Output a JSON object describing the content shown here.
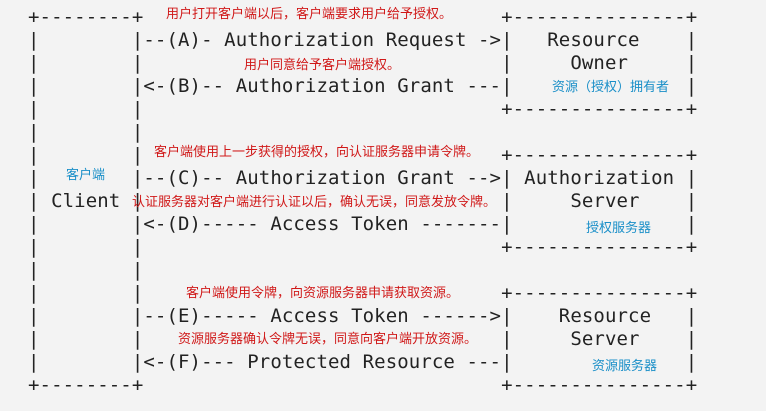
{
  "colors": {
    "background": "#f3f3f3",
    "diagram_text": "#222222",
    "annotation_red": "#d01818",
    "annotation_blue": "#1a8fc8"
  },
  "diagram_lines": [
    "+--------+                               +---------------+",
    "|        |--(A)- Authorization Request ->|   Resource    |",
    "|        |                               |     Owner     |",
    "|        |<-(B)-- Authorization Grant ---|               |",
    "|        |                               +---------------+",
    "|        |",
    "|        |                               +---------------+",
    "|        |--(C)-- Authorization Grant -->| Authorization |",
    "| Client |                               |     Server    |",
    "|        |<-(D)----- Access Token -------|               |",
    "|        |                               +---------------+",
    "|        |",
    "|        |                               +---------------+",
    "|        |--(E)----- Access Token ------>|    Resource   |",
    "|        |                               |     Server    |",
    "|        |<-(F)--- Protected Resource ---|               |",
    "+--------+                               +---------------+"
  ],
  "annotations": {
    "step_a": "用户打开客户端以后，客户端要求用户给予授权。",
    "step_b": "用户同意给予客户端授权。",
    "resource_owner": "资源（授权）拥有者",
    "step_c": "客户端使用上一步获得的授权，向认证服务器申请令牌。",
    "client": "客户端",
    "step_d": "认证服务器对客户端进行认证以后，确认无误，同意发放令牌。",
    "authorization_server": "授权服务器",
    "step_e": "客户端使用令牌，向资源服务器申请获取资源。",
    "step_f": "资源服务器确认令牌无误，同意向客户端开放资源。",
    "resource_server": "资源服务器"
  }
}
